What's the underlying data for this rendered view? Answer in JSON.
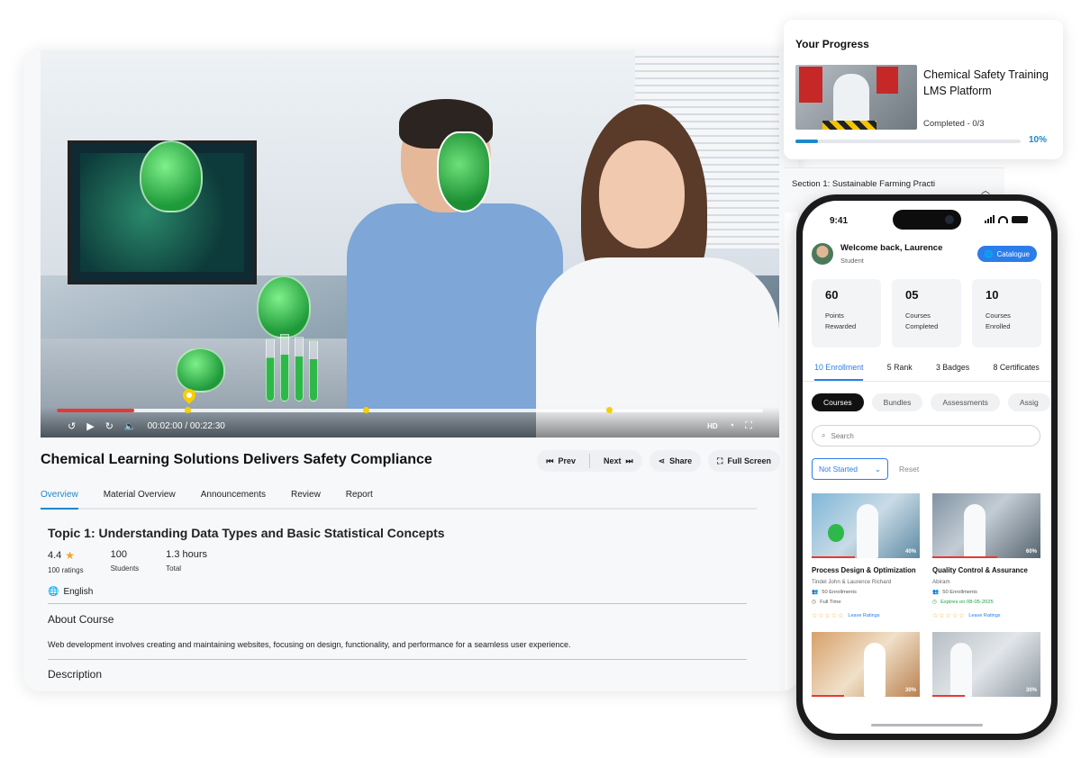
{
  "video": {
    "current_time": "00:02:00",
    "separator": " / ",
    "duration": "00:22:30",
    "progress_fraction": 0.11,
    "quality_label": "HD"
  },
  "course": {
    "title": "Chemical Learning Solutions Delivers Safety Compliance",
    "actions": {
      "prev": "Prev",
      "next": "Next",
      "share": "Share",
      "full_screen": "Full Screen"
    },
    "tabs": [
      {
        "label": "Overview",
        "active": true
      },
      {
        "label": "Material Overview",
        "active": false
      },
      {
        "label": "Announcements",
        "active": false
      },
      {
        "label": "Review",
        "active": false
      },
      {
        "label": "Report",
        "active": false
      }
    ],
    "topic_title": "Topic 1: Understanding Data Types and Basic Statistical Concepts",
    "stats": [
      {
        "value": "4.4",
        "label": "100 ratings"
      },
      {
        "value": "100",
        "label": "Students"
      },
      {
        "value": "1.3 hours",
        "label": "Total"
      }
    ],
    "language": "English",
    "about_heading": "About Course",
    "about_text": "Web development involves creating and maintaining websites, focusing on design, functionality, and performance for a seamless user experience.",
    "description_heading": "Description"
  },
  "progress_card": {
    "heading": "Your Progress",
    "course_name": "Chemical Safety Training LMS Platform",
    "completed": "Completed - 0/3",
    "percent": "10%",
    "fraction": 0.1
  },
  "section": {
    "title": "Section 1: Sustainable Farming Practi"
  },
  "phone": {
    "time": "9:41",
    "welcome": "Welcome back, Laurence",
    "role": "Student",
    "catalogue": "Catalogue",
    "kpis": [
      {
        "value": "60",
        "l1": "Points",
        "l2": "Rewarded"
      },
      {
        "value": "05",
        "l1": "Courses",
        "l2": "Completed"
      },
      {
        "value": "10",
        "l1": "Courses",
        "l2": "Enrolled"
      }
    ],
    "tabs": [
      {
        "label": "10 Enrollment",
        "active": true
      },
      {
        "label": "5 Rank",
        "active": false
      },
      {
        "label": "3 Badges",
        "active": false
      },
      {
        "label": "8 Certificates",
        "active": false
      }
    ],
    "chips": [
      "Courses",
      "Bundles",
      "Assessments",
      "Assig"
    ],
    "search_placeholder": "Search",
    "filter_value": "Not Started",
    "reset": "Reset",
    "cards": [
      {
        "title": "Process Design & Optimization",
        "author": "Tindel John & Laurence Richard",
        "enrollments": "50 Enrollments",
        "meta": "Full Time",
        "meta_expiry": false,
        "progress": "40%",
        "fraction": 0.4,
        "leave": "Leave Ratings"
      },
      {
        "title": "Quality Control & Assurance",
        "author": "Abiram",
        "enrollments": "50 Enrollments",
        "meta": "Expires on 08-05-2025",
        "meta_expiry": true,
        "progress": "60%",
        "fraction": 0.6,
        "leave": "Leave Ratings"
      },
      {
        "progress": "30%",
        "fraction": 0.3
      },
      {
        "progress": "30%",
        "fraction": 0.3
      }
    ]
  }
}
